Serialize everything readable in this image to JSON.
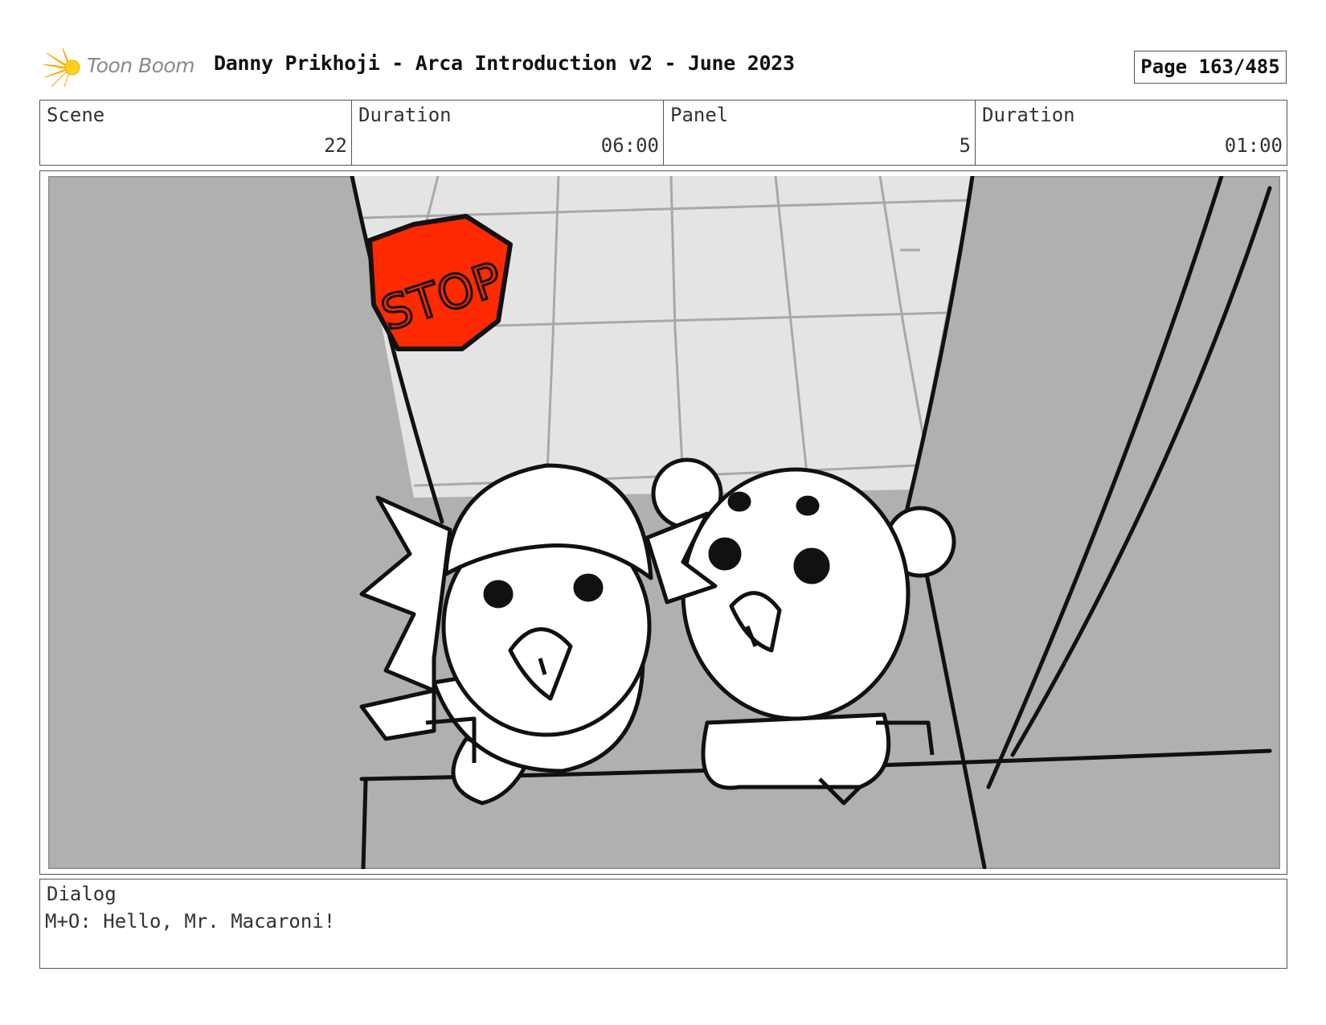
{
  "header": {
    "logo_text": "Toon Boom",
    "title": "Danny Prikhoji - Arca Introduction v2 - June 2023",
    "page": "Page 163/485"
  },
  "info": {
    "scene_label": "Scene",
    "scene_value": "22",
    "scene_duration_label": "Duration",
    "scene_duration_value": "06:00",
    "panel_label": "Panel",
    "panel_value": "5",
    "panel_duration_label": "Duration",
    "panel_duration_value": "01:00"
  },
  "panel": {
    "sign_text": "STOP"
  },
  "dialog": {
    "label": "Dialog",
    "text": "M+O: Hello, Mr. Macaroni!"
  },
  "colors": {
    "stop_sign": "#ff2a00",
    "wall_gray": "#b0b0b0",
    "ceiling": "#e4e4e4",
    "logo_yellow": "#ffd21a"
  }
}
